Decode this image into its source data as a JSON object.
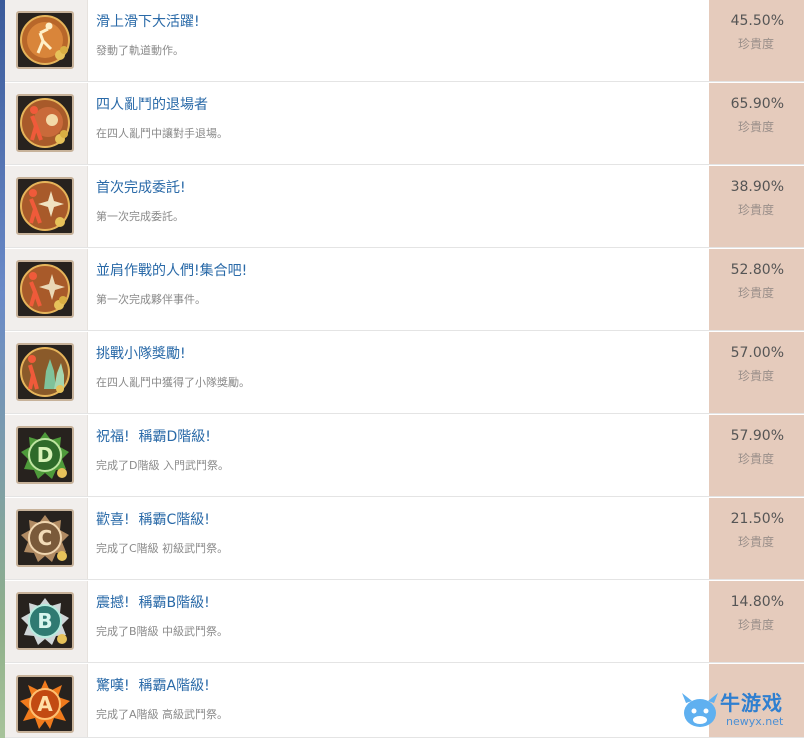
{
  "achievements": [
    {
      "title": "滑上滑下大活躍!",
      "desc": "發動了軌道動作。",
      "percent": "45.50%",
      "rarity_label": "珍貴度",
      "icon": "skate-figure-icon",
      "icon_color": "#e56a2c"
    },
    {
      "title": "四人亂鬥的退場者",
      "desc": "在四人亂鬥中讓對手退場。",
      "percent": "65.90%",
      "rarity_label": "珍貴度",
      "icon": "brawl-exit-icon",
      "icon_color": "#e4522b"
    },
    {
      "title": "首次完成委託!",
      "desc": "第一次完成委託。",
      "percent": "38.90%",
      "rarity_label": "珍貴度",
      "icon": "shuriken-figure-icon",
      "icon_color": "#e55a2a"
    },
    {
      "title": "並肩作戰的人們!集合吧!",
      "desc": "第一次完成夥伴事件。",
      "percent": "52.80%",
      "rarity_label": "珍貴度",
      "icon": "partners-icon",
      "icon_color": "#e0582b"
    },
    {
      "title": "挑戰小隊獎勵!",
      "desc": "在四人亂鬥中獲得了小隊獎勵。",
      "percent": "57.00%",
      "rarity_label": "珍貴度",
      "icon": "team-reward-icon",
      "icon_color": "#d85a2c"
    },
    {
      "title": "祝福!  稱霸D階級!",
      "desc": "完成了D階級 入門武鬥祭。",
      "percent": "57.90%",
      "rarity_label": "珍貴度",
      "icon": "rank-d-icon",
      "icon_color": "#4ca84a",
      "rank_letter": "D"
    },
    {
      "title": "歡喜!  稱霸C階級!",
      "desc": "完成了C階級 初級武鬥祭。",
      "percent": "21.50%",
      "rarity_label": "珍貴度",
      "icon": "rank-c-icon",
      "icon_color": "#c9a07a",
      "rank_letter": "C"
    },
    {
      "title": "震撼!  稱霸B階級!",
      "desc": "完成了B階級 中級武鬥祭。",
      "percent": "14.80%",
      "rarity_label": "珍貴度",
      "icon": "rank-b-icon",
      "icon_color": "#3fa89a",
      "rank_letter": "B"
    },
    {
      "title": "驚嘆!  稱霸A階級!",
      "desc": "完成了A階級 高級武鬥祭。",
      "percent": "",
      "rarity_label": "",
      "icon": "rank-a-icon",
      "icon_color": "#e8701c",
      "rank_letter": "A"
    }
  ],
  "watermark": {
    "name": "牛游戏",
    "url": "newyx.net"
  }
}
